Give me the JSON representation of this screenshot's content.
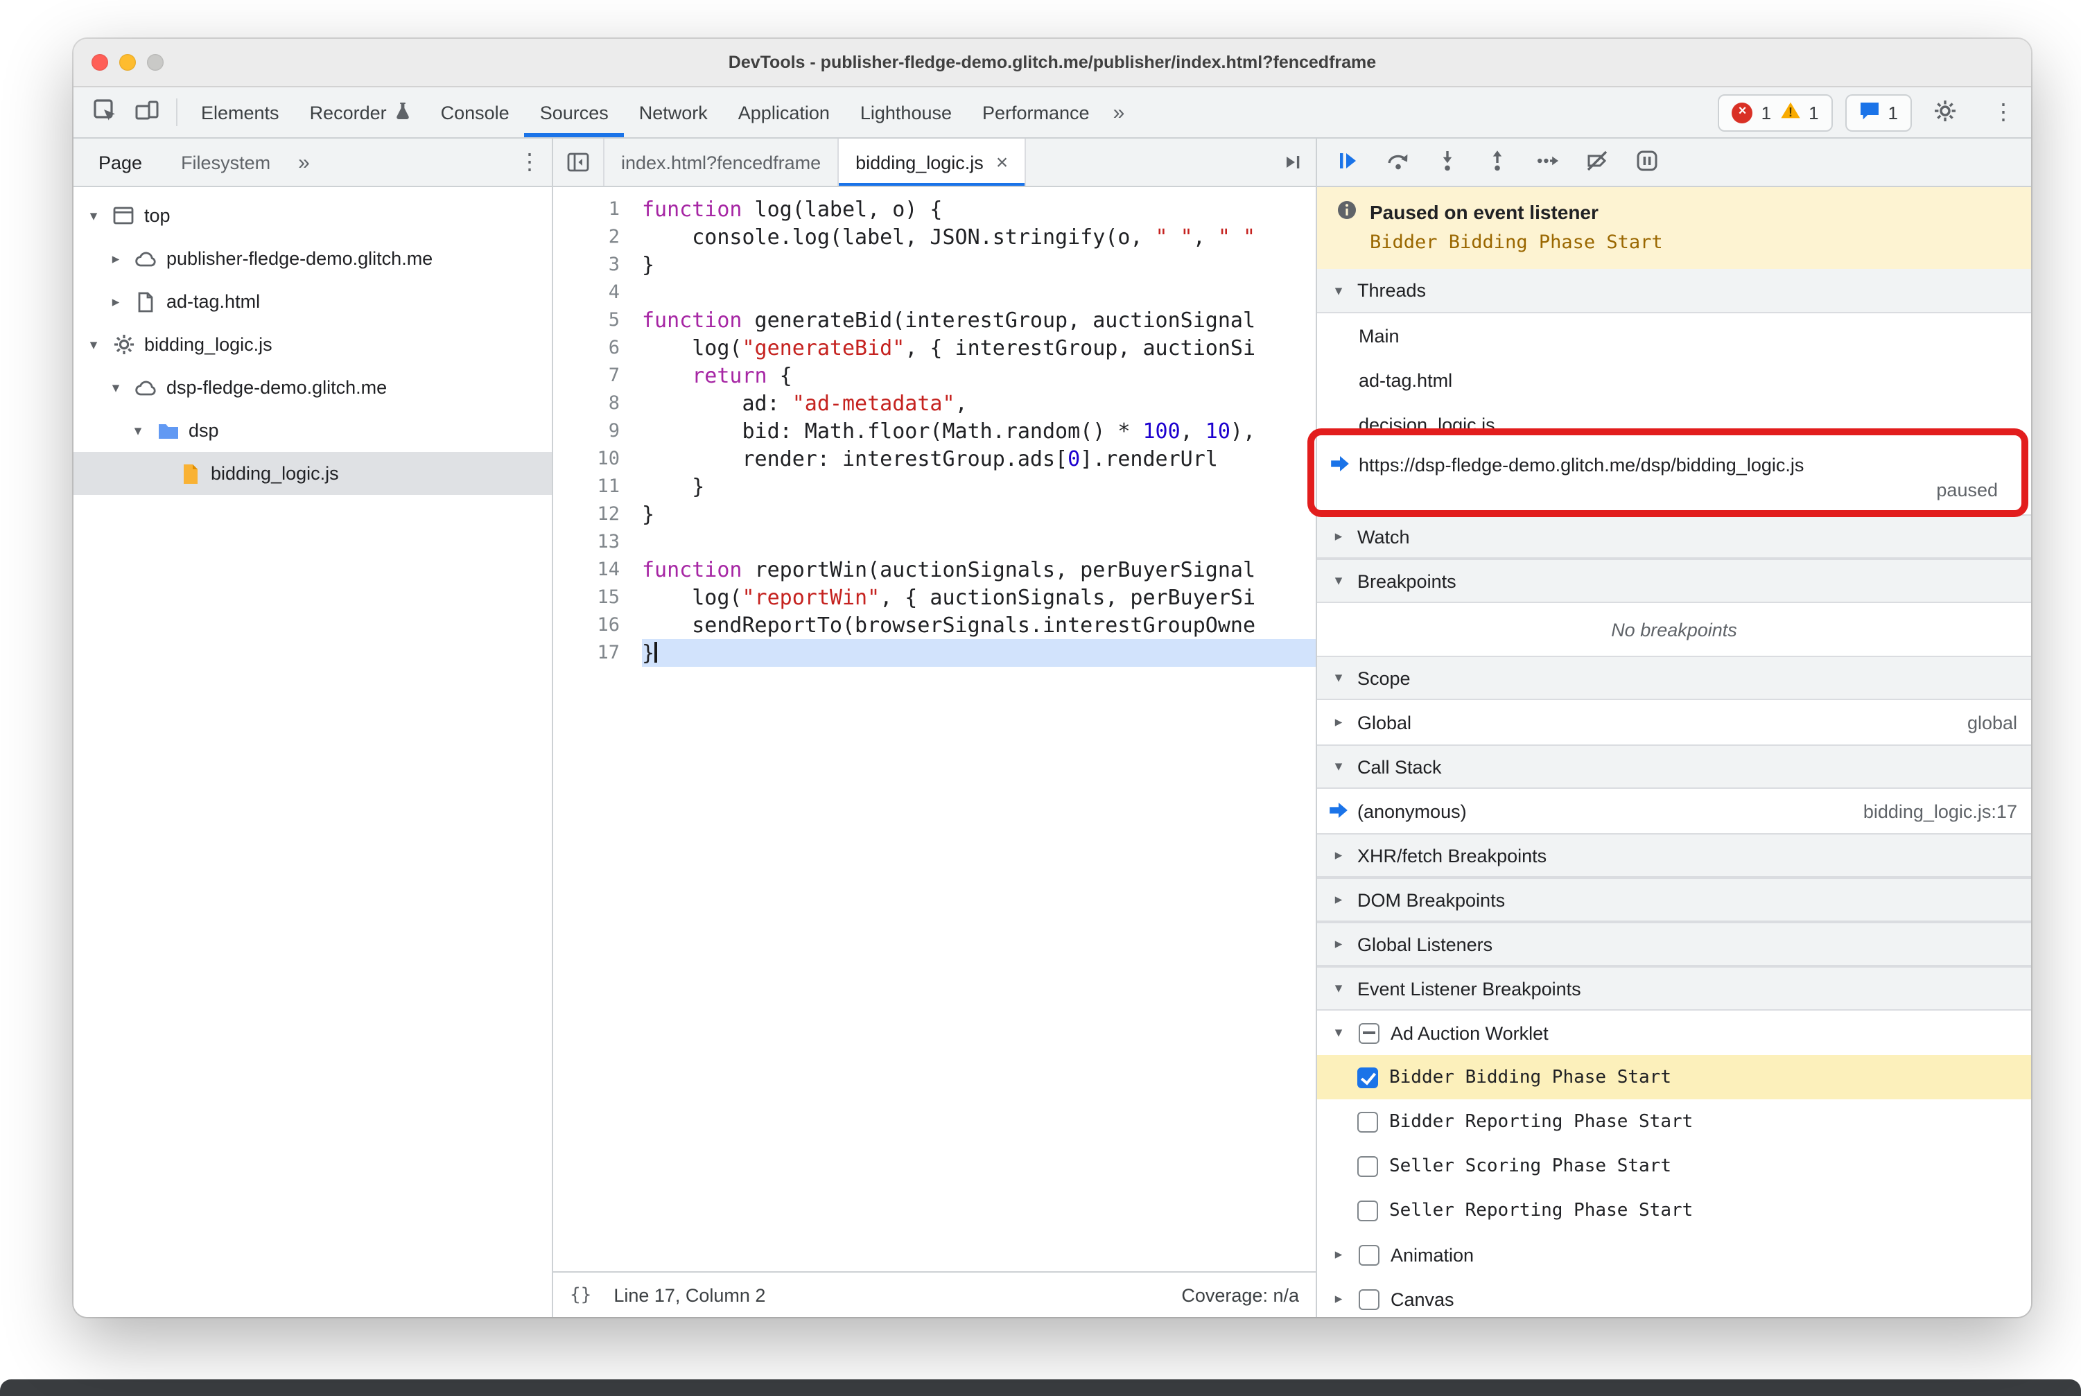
{
  "window": {
    "title": "DevTools - publisher-fledge-demo.glitch.me/publisher/index.html?fencedframe"
  },
  "main_toolbar": {
    "panels": [
      "Elements",
      "Recorder",
      "Console",
      "Sources",
      "Network",
      "Application",
      "Lighthouse",
      "Performance"
    ],
    "active_panel": "Sources",
    "overflow": "»",
    "errors": "1",
    "warnings": "1",
    "issues": "1"
  },
  "navigator": {
    "tabs": [
      "Page",
      "Filesystem"
    ],
    "active_tab": "Page",
    "overflow": "»",
    "tree": [
      {
        "indent": 0,
        "expand": "open",
        "icon": "frame",
        "label": "top"
      },
      {
        "indent": 1,
        "expand": "closed",
        "icon": "cloud",
        "label": "publisher-fledge-demo.glitch.me"
      },
      {
        "indent": 1,
        "expand": "closed",
        "icon": "doc",
        "label": "ad-tag.html"
      },
      {
        "indent": 0,
        "expand": "open",
        "icon": "gear",
        "label": "bidding_logic.js"
      },
      {
        "indent": 1,
        "expand": "open",
        "icon": "cloud",
        "label": "dsp-fledge-demo.glitch.me"
      },
      {
        "indent": 2,
        "expand": "open",
        "icon": "folder",
        "label": "dsp"
      },
      {
        "indent": 3,
        "expand": "none",
        "icon": "file",
        "label": "bidding_logic.js",
        "selected": true
      }
    ]
  },
  "editor": {
    "tabs": [
      {
        "label": "index.html?fencedframe",
        "active": false
      },
      {
        "label": "bidding_logic.js",
        "active": true,
        "close": "×"
      }
    ],
    "status": {
      "brackets": "{}",
      "position": "Line 17, Column 2",
      "coverage": "Coverage: n/a"
    },
    "lines": [
      {
        "n": "1",
        "hl": false,
        "seg": [
          [
            "kw",
            "function"
          ],
          [
            "pl",
            " log(label, o) {"
          ]
        ]
      },
      {
        "n": "2",
        "hl": false,
        "seg": [
          [
            "pl",
            "    console.log(label, JSON.stringify(o, "
          ],
          [
            "str",
            "\" \""
          ],
          [
            "pl",
            ", "
          ],
          [
            "str",
            "\" \""
          ]
        ]
      },
      {
        "n": "3",
        "hl": false,
        "seg": [
          [
            "pl",
            "}"
          ]
        ]
      },
      {
        "n": "4",
        "hl": false,
        "seg": []
      },
      {
        "n": "5",
        "hl": false,
        "seg": [
          [
            "kw",
            "function"
          ],
          [
            "pl",
            " generateBid(interestGroup, auctionSignal"
          ]
        ]
      },
      {
        "n": "6",
        "hl": false,
        "seg": [
          [
            "pl",
            "    log("
          ],
          [
            "str",
            "\"generateBid\""
          ],
          [
            "pl",
            ", { interestGroup, auctionSi"
          ]
        ]
      },
      {
        "n": "7",
        "hl": false,
        "seg": [
          [
            "pl",
            "    "
          ],
          [
            "kw",
            "return"
          ],
          [
            "pl",
            " {"
          ]
        ]
      },
      {
        "n": "8",
        "hl": false,
        "seg": [
          [
            "pl",
            "        ad: "
          ],
          [
            "str",
            "\"ad-metadata\""
          ],
          [
            "pl",
            ","
          ]
        ]
      },
      {
        "n": "9",
        "hl": false,
        "seg": [
          [
            "pl",
            "        bid: Math.floor(Math.random() * "
          ],
          [
            "num",
            "100"
          ],
          [
            "pl",
            ", "
          ],
          [
            "num",
            "10"
          ],
          [
            "pl",
            "),"
          ]
        ]
      },
      {
        "n": "10",
        "hl": false,
        "seg": [
          [
            "pl",
            "        render: interestGroup.ads["
          ],
          [
            "num",
            "0"
          ],
          [
            "pl",
            "].renderUrl"
          ]
        ]
      },
      {
        "n": "11",
        "hl": false,
        "seg": [
          [
            "pl",
            "    }"
          ]
        ]
      },
      {
        "n": "12",
        "hl": false,
        "seg": [
          [
            "pl",
            "}"
          ]
        ]
      },
      {
        "n": "13",
        "hl": false,
        "seg": []
      },
      {
        "n": "14",
        "hl": false,
        "seg": [
          [
            "kw",
            "function"
          ],
          [
            "pl",
            " reportWin(auctionSignals, perBuyerSignal"
          ]
        ]
      },
      {
        "n": "15",
        "hl": false,
        "seg": [
          [
            "pl",
            "    log("
          ],
          [
            "str",
            "\"reportWin\""
          ],
          [
            "pl",
            ", { auctionSignals, perBuyerSi"
          ]
        ]
      },
      {
        "n": "16",
        "hl": false,
        "seg": [
          [
            "pl",
            "    sendReportTo(browserSignals.interestGroupOwne"
          ]
        ]
      },
      {
        "n": "17",
        "hl": true,
        "seg": [
          [
            "pl",
            "}"
          ]
        ]
      }
    ]
  },
  "debugger": {
    "toolbar_icons": [
      "resume",
      "step-over",
      "step-into",
      "step-out",
      "step",
      "deactivate-breakpoints",
      "pause-on-exceptions"
    ],
    "paused_banner": {
      "title": "Paused on event listener",
      "event": "Bidder Bidding Phase Start"
    },
    "threads": {
      "title": "Threads",
      "items": [
        {
          "label": "Main"
        },
        {
          "label": "ad-tag.html"
        },
        {
          "label": "decision_logic.js"
        },
        {
          "label": "https://dsp-fledge-demo.glitch.me/dsp/bidding_logic.js",
          "status": "paused",
          "current": true,
          "annotated": true
        }
      ]
    },
    "watch": {
      "title": "Watch"
    },
    "breakpoints": {
      "title": "Breakpoints",
      "empty": "No breakpoints"
    },
    "scope": {
      "title": "Scope",
      "rows": [
        {
          "label": "Global",
          "value": "global"
        }
      ]
    },
    "call_stack": {
      "title": "Call Stack",
      "frames": [
        {
          "label": "(anonymous)",
          "location": "bidding_logic.js:17",
          "current": true
        }
      ]
    },
    "xhr_breakpoints": {
      "title": "XHR/fetch Breakpoints"
    },
    "dom_breakpoints": {
      "title": "DOM Breakpoints"
    },
    "global_listeners": {
      "title": "Global Listeners"
    },
    "event_listener_breakpoints": {
      "title": "Event Listener Breakpoints",
      "items": [
        {
          "type": "category",
          "expand": "open",
          "checkbox": "indeterminate",
          "label": "Ad Auction Worklet"
        },
        {
          "type": "event",
          "checkbox": "checked",
          "label": "Bidder Bidding Phase Start",
          "highlighted": true
        },
        {
          "type": "event",
          "checkbox": "unchecked",
          "label": "Bidder Reporting Phase Start"
        },
        {
          "type": "event",
          "checkbox": "unchecked",
          "label": "Seller Scoring Phase Start"
        },
        {
          "type": "event",
          "checkbox": "unchecked",
          "label": "Seller Reporting Phase Start"
        },
        {
          "type": "category",
          "expand": "closed",
          "checkbox": "unchecked",
          "label": "Animation"
        },
        {
          "type": "category",
          "expand": "closed",
          "checkbox": "unchecked",
          "label": "Canvas"
        }
      ]
    }
  },
  "colors": {
    "accent": "#1a73e8",
    "error": "#d93025",
    "warning": "#f9ab00",
    "annotation": "#e21d1d",
    "banner_bg": "#fdf3d2",
    "highlight_row": "#fcf0bb"
  }
}
